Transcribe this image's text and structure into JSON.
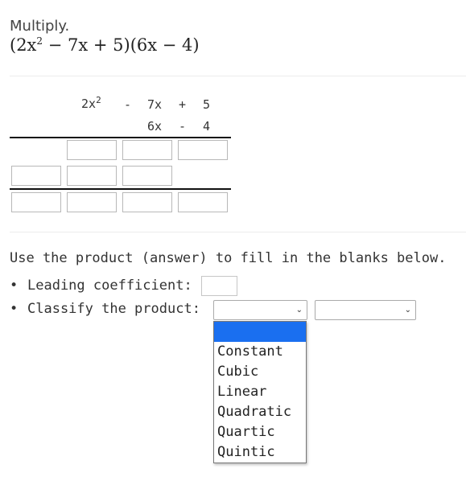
{
  "problem": {
    "prompt": "Multiply.",
    "factor1": "(2x",
    "exp": "2",
    "factor1_rest": " − 7x + 5)",
    "factor2": "(6x − 4)"
  },
  "setup": {
    "row1": {
      "t1": "2x",
      "t1_exp": "2",
      "op1": "-",
      "t2": "7x",
      "op2": "+",
      "t3": "5"
    },
    "row2": {
      "t1": "6x",
      "op1": "-",
      "t2": "4"
    }
  },
  "fill": {
    "instruction": "Use the product (answer) to fill in the blanks below.",
    "bullet": "•",
    "leading_label": "Leading coefficient:",
    "classify_label": "Classify the product:",
    "leading_value": "",
    "classify_selected_1": "",
    "classify_selected_2": ""
  },
  "dropdown": {
    "options": [
      "Constant",
      "Cubic",
      "Linear",
      "Quadratic",
      "Quartic",
      "Quintic"
    ],
    "highlight_color": "#1a6ff0"
  },
  "icons": {
    "select_chevron": "chevron-down-icon"
  }
}
